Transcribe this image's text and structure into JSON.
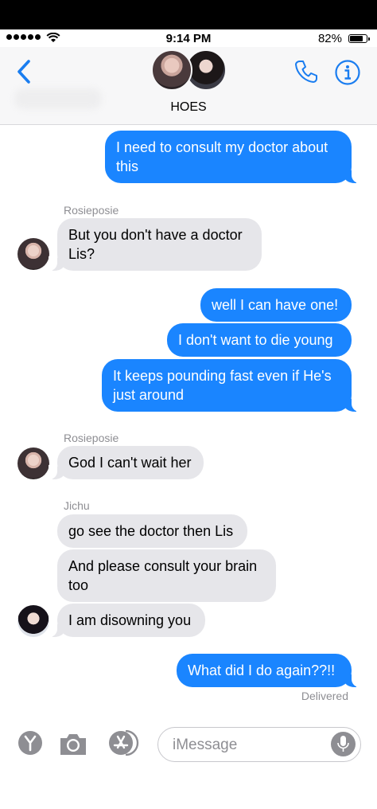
{
  "status_bar": {
    "time": "9:14 PM",
    "battery": "82%",
    "battery_level": 0.82
  },
  "header": {
    "title": "HOES"
  },
  "messages": [
    {
      "text": "I need to consult my doctor about this",
      "from": "me"
    },
    {
      "sender": "Rosieposie"
    },
    {
      "text": "But you don't have a doctor Lis?",
      "from": "Rosieposie"
    },
    {
      "text": "well I can have one!",
      "from": "me"
    },
    {
      "text": "I don't want to die young",
      "from": "me"
    },
    {
      "text": "It keeps pounding fast even if He's just around",
      "from": "me"
    },
    {
      "sender": "Rosieposie"
    },
    {
      "text": "God I can't wait her",
      "from": "Rosieposie"
    },
    {
      "sender": "Jichu"
    },
    {
      "text": "go see the doctor then Lis",
      "from": "Jichu"
    },
    {
      "text": "And please consult your brain too",
      "from": "Jichu"
    },
    {
      "text": "I am disowning you",
      "from": "Jichu"
    },
    {
      "text": "What did I do again??!!",
      "from": "me"
    }
  ],
  "delivered": "Delivered",
  "compose": {
    "placeholder": "iMessage"
  },
  "colors": {
    "outgoing": "#1a85ff",
    "incoming": "#e6e6ea",
    "accent": "#1a7df0"
  }
}
